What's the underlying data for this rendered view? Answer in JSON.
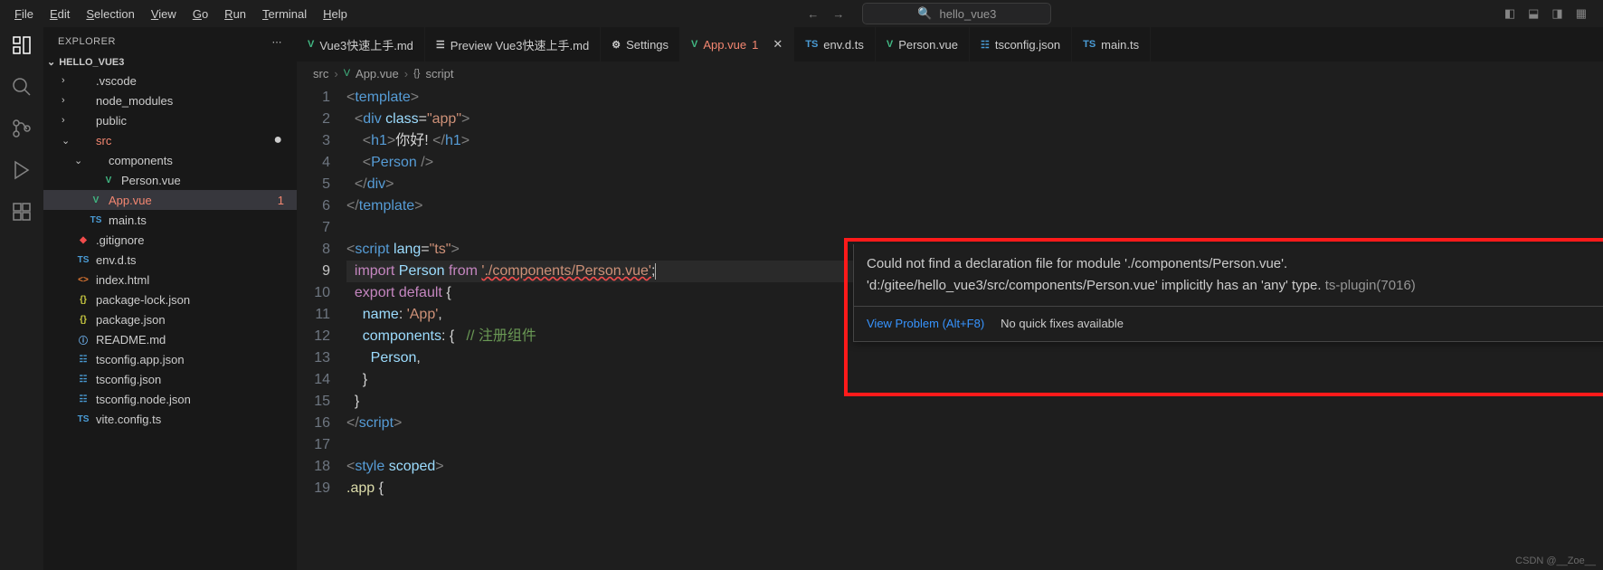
{
  "menu": [
    "File",
    "Edit",
    "Selection",
    "View",
    "Go",
    "Run",
    "Terminal",
    "Help"
  ],
  "search_placeholder": "hello_vue3",
  "sidebar": {
    "title": "EXPLORER",
    "project": "HELLO_VUE3",
    "tree": [
      {
        "indent": 1,
        "chev": "›",
        "icon": "",
        "label": ".vscode",
        "cls": ""
      },
      {
        "indent": 1,
        "chev": "›",
        "icon": "",
        "label": "node_modules",
        "cls": ""
      },
      {
        "indent": 1,
        "chev": "›",
        "icon": "",
        "label": "public",
        "cls": ""
      },
      {
        "indent": 1,
        "chev": "⌄",
        "icon": "",
        "label": "src",
        "cls": "error-text",
        "trail": "dot"
      },
      {
        "indent": 2,
        "chev": "⌄",
        "icon": "",
        "label": "components",
        "cls": ""
      },
      {
        "indent": 3,
        "chev": "",
        "icon": "V",
        "iconcls": "ic-vue",
        "label": "Person.vue",
        "cls": ""
      },
      {
        "indent": 2,
        "chev": "",
        "icon": "V",
        "iconcls": "ic-vue",
        "label": "App.vue",
        "cls": "error-text",
        "selected": true,
        "trail": "1"
      },
      {
        "indent": 2,
        "chev": "",
        "icon": "TS",
        "iconcls": "ic-ts",
        "label": "main.ts",
        "cls": ""
      },
      {
        "indent": 1,
        "chev": "",
        "icon": "◆",
        "iconcls": "ic-git",
        "label": ".gitignore",
        "cls": ""
      },
      {
        "indent": 1,
        "chev": "",
        "icon": "TS",
        "iconcls": "ic-ts",
        "label": "env.d.ts",
        "cls": ""
      },
      {
        "indent": 1,
        "chev": "",
        "icon": "<>",
        "iconcls": "ic-html",
        "label": "index.html",
        "cls": ""
      },
      {
        "indent": 1,
        "chev": "",
        "icon": "{}",
        "iconcls": "ic-json",
        "label": "package-lock.json",
        "cls": ""
      },
      {
        "indent": 1,
        "chev": "",
        "icon": "{}",
        "iconcls": "ic-json",
        "label": "package.json",
        "cls": ""
      },
      {
        "indent": 1,
        "chev": "",
        "icon": "ⓘ",
        "iconcls": "ic-info",
        "label": "README.md",
        "cls": ""
      },
      {
        "indent": 1,
        "chev": "",
        "icon": "☷",
        "iconcls": "ic-ts",
        "label": "tsconfig.app.json",
        "cls": ""
      },
      {
        "indent": 1,
        "chev": "",
        "icon": "☷",
        "iconcls": "ic-ts",
        "label": "tsconfig.json",
        "cls": ""
      },
      {
        "indent": 1,
        "chev": "",
        "icon": "☷",
        "iconcls": "ic-ts",
        "label": "tsconfig.node.json",
        "cls": ""
      },
      {
        "indent": 1,
        "chev": "",
        "icon": "TS",
        "iconcls": "ic-ts",
        "label": "vite.config.ts",
        "cls": ""
      }
    ]
  },
  "tabs": [
    {
      "icon": "V",
      "iconcls": "ic-vue",
      "label": "Vue3快速上手.md",
      "active": false
    },
    {
      "icon": "☰",
      "iconcls": "",
      "label": "Preview Vue3快速上手.md",
      "active": false
    },
    {
      "icon": "⚙",
      "iconcls": "",
      "label": "Settings",
      "active": false
    },
    {
      "icon": "V",
      "iconcls": "ic-vue",
      "label": "App.vue",
      "active": true,
      "badge": "1",
      "close": true
    },
    {
      "icon": "TS",
      "iconcls": "ic-ts",
      "label": "env.d.ts",
      "active": false
    },
    {
      "icon": "V",
      "iconcls": "ic-vue",
      "label": "Person.vue",
      "active": false
    },
    {
      "icon": "☷",
      "iconcls": "ic-ts",
      "label": "tsconfig.json",
      "active": false
    },
    {
      "icon": "TS",
      "iconcls": "ic-ts",
      "label": "main.ts",
      "active": false
    }
  ],
  "breadcrumbs": [
    "src",
    "App.vue",
    "script"
  ],
  "breadcrumb_icons": [
    "",
    "V",
    "{}"
  ],
  "code": {
    "lines": [
      [
        {
          "t": "t-br",
          "s": "<"
        },
        {
          "t": "t-tag",
          "s": "template"
        },
        {
          "t": "t-br",
          "s": ">"
        }
      ],
      [
        {
          "t": "",
          "s": "  "
        },
        {
          "t": "t-br",
          "s": "<"
        },
        {
          "t": "t-tag",
          "s": "div"
        },
        {
          "t": "",
          "s": " "
        },
        {
          "t": "t-attr",
          "s": "class"
        },
        {
          "t": "t-txt",
          "s": "="
        },
        {
          "t": "t-str",
          "s": "\"app\""
        },
        {
          "t": "t-br",
          "s": ">"
        }
      ],
      [
        {
          "t": "",
          "s": "    "
        },
        {
          "t": "t-br",
          "s": "<"
        },
        {
          "t": "t-tag",
          "s": "h1"
        },
        {
          "t": "t-br",
          "s": ">"
        },
        {
          "t": "t-txt",
          "s": "你好! "
        },
        {
          "t": "t-br",
          "s": "</"
        },
        {
          "t": "t-tag",
          "s": "h1"
        },
        {
          "t": "t-br",
          "s": ">"
        }
      ],
      [
        {
          "t": "",
          "s": "    "
        },
        {
          "t": "t-br",
          "s": "<"
        },
        {
          "t": "t-tag",
          "s": "Person"
        },
        {
          "t": "",
          "s": " "
        },
        {
          "t": "t-br",
          "s": "/>"
        }
      ],
      [
        {
          "t": "",
          "s": "  "
        },
        {
          "t": "t-br",
          "s": "</"
        },
        {
          "t": "t-tag",
          "s": "div"
        },
        {
          "t": "t-br",
          "s": ">"
        }
      ],
      [
        {
          "t": "t-br",
          "s": "</"
        },
        {
          "t": "t-tag",
          "s": "template"
        },
        {
          "t": "t-br",
          "s": ">"
        }
      ],
      [],
      [
        {
          "t": "t-br",
          "s": "<"
        },
        {
          "t": "t-tag",
          "s": "script"
        },
        {
          "t": "",
          "s": " "
        },
        {
          "t": "t-attr",
          "s": "lang"
        },
        {
          "t": "t-txt",
          "s": "="
        },
        {
          "t": "t-str",
          "s": "\"ts\""
        },
        {
          "t": "t-br",
          "s": ">"
        }
      ],
      [
        {
          "t": "",
          "s": "  "
        },
        {
          "t": "t-kw",
          "s": "import"
        },
        {
          "t": "",
          "s": " "
        },
        {
          "t": "t-id",
          "s": "Person"
        },
        {
          "t": "",
          "s": " "
        },
        {
          "t": "t-kw",
          "s": "from"
        },
        {
          "t": "",
          "s": " "
        },
        {
          "t": "t-str err-underline",
          "s": "'./components/Person.vue'"
        },
        {
          "t": "t-txt",
          "s": ";"
        }
      ],
      [
        {
          "t": "",
          "s": "  "
        },
        {
          "t": "t-kw",
          "s": "export"
        },
        {
          "t": "",
          "s": " "
        },
        {
          "t": "t-kw",
          "s": "default"
        },
        {
          "t": "",
          "s": " "
        },
        {
          "t": "t-txt",
          "s": "{"
        }
      ],
      [
        {
          "t": "",
          "s": "    "
        },
        {
          "t": "t-id",
          "s": "name"
        },
        {
          "t": "t-txt",
          "s": ": "
        },
        {
          "t": "t-str",
          "s": "'App'"
        },
        {
          "t": "t-txt",
          "s": ","
        }
      ],
      [
        {
          "t": "",
          "s": "    "
        },
        {
          "t": "t-id",
          "s": "components"
        },
        {
          "t": "t-txt",
          "s": ": {   "
        },
        {
          "t": "t-cm",
          "s": "// 注册组件"
        }
      ],
      [
        {
          "t": "",
          "s": "      "
        },
        {
          "t": "t-id",
          "s": "Person"
        },
        {
          "t": "t-txt",
          "s": ","
        }
      ],
      [
        {
          "t": "",
          "s": "    "
        },
        {
          "t": "t-txt",
          "s": "}"
        }
      ],
      [
        {
          "t": "",
          "s": "  "
        },
        {
          "t": "t-txt",
          "s": "}"
        }
      ],
      [
        {
          "t": "t-br",
          "s": "</"
        },
        {
          "t": "t-tag",
          "s": "script"
        },
        {
          "t": "t-br",
          "s": ">"
        }
      ],
      [],
      [
        {
          "t": "t-br",
          "s": "<"
        },
        {
          "t": "t-tag",
          "s": "style"
        },
        {
          "t": "",
          "s": " "
        },
        {
          "t": "t-attr",
          "s": "scoped"
        },
        {
          "t": "t-br",
          "s": ">"
        }
      ],
      [
        {
          "t": "t-fn",
          "s": ".app"
        },
        {
          "t": "",
          "s": " "
        },
        {
          "t": "t-txt",
          "s": "{"
        }
      ]
    ],
    "current_line": 9
  },
  "hover": {
    "msg1": "Could not find a declaration file for module './components/Person.vue'.",
    "msg2a": "'d:/gitee/hello_vue3/src/components/Person.vue' implicitly has an 'any' type.",
    "msg2b": "ts-plugin(7016)",
    "link": "View Problem (Alt+F8)",
    "noquick": "No quick fixes available"
  },
  "watermark": "CSDN @__Zoe__"
}
